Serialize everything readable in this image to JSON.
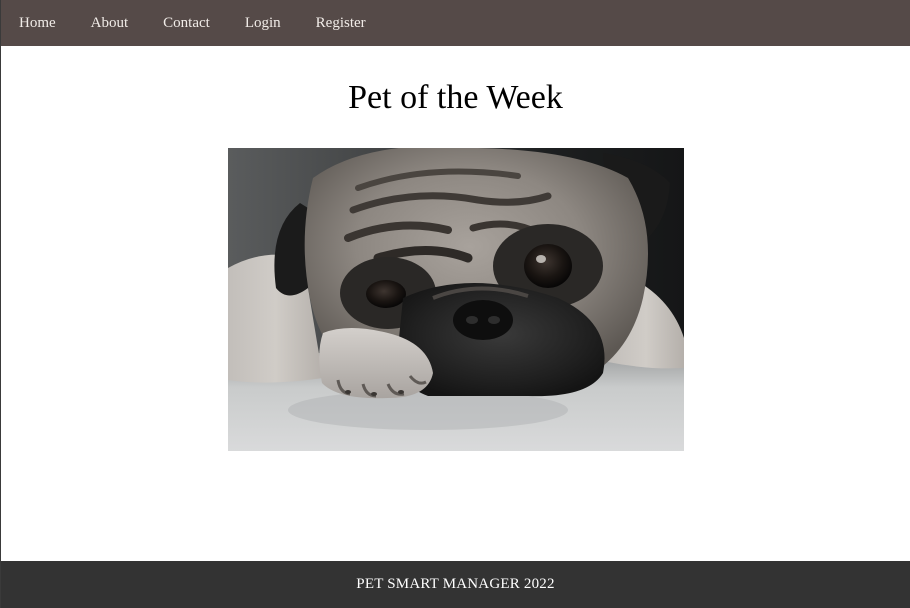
{
  "nav": {
    "items": [
      {
        "label": "Home"
      },
      {
        "label": "About"
      },
      {
        "label": "Contact"
      },
      {
        "label": "Login"
      },
      {
        "label": "Register"
      }
    ]
  },
  "main": {
    "title": "Pet of the Week",
    "image_subject": "pug"
  },
  "footer": {
    "text": "PET SMART MANAGER 2022"
  },
  "colors": {
    "nav_background": "#554a48",
    "nav_text": "#f1ece8",
    "footer_background": "#333333",
    "footer_text": "#ffffff",
    "page_background": "#ffffff"
  }
}
